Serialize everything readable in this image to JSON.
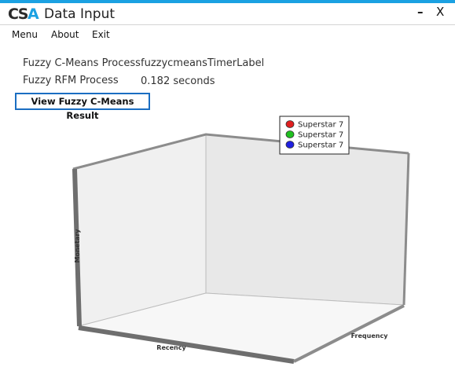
{
  "window": {
    "logo_part1": "CS",
    "logo_part2": "A",
    "title": "Data Input",
    "minimize_glyph": "–",
    "close_glyph": "X"
  },
  "menu": {
    "items": [
      {
        "label": "Menu"
      },
      {
        "label": "About"
      },
      {
        "label": "Exit"
      }
    ]
  },
  "info": {
    "fcm_label": "Fuzzy C-Means Process",
    "fcm_value": "fuzzycmeansTimerLabel",
    "rfm_label": "Fuzzy RFM Process",
    "rfm_value": "0.182 seconds"
  },
  "result_button": {
    "label": "View Fuzzy C-Means Result"
  },
  "chart_data": {
    "type": "scatter",
    "xlabel": "Recency",
    "ylabel": "Monetary",
    "zlabel": "Frequency",
    "grid": false,
    "legend_placement": "top-right",
    "series": [
      {
        "name": "Superstar 7",
        "color": "#e02020",
        "points": []
      },
      {
        "name": "Superstar 7",
        "color": "#20c020",
        "points": []
      },
      {
        "name": "Superstar 7",
        "color": "#2020e0",
        "points": []
      }
    ]
  },
  "colors": {
    "accent": "#1ba1e2",
    "button_border": "#1b6ec2"
  }
}
